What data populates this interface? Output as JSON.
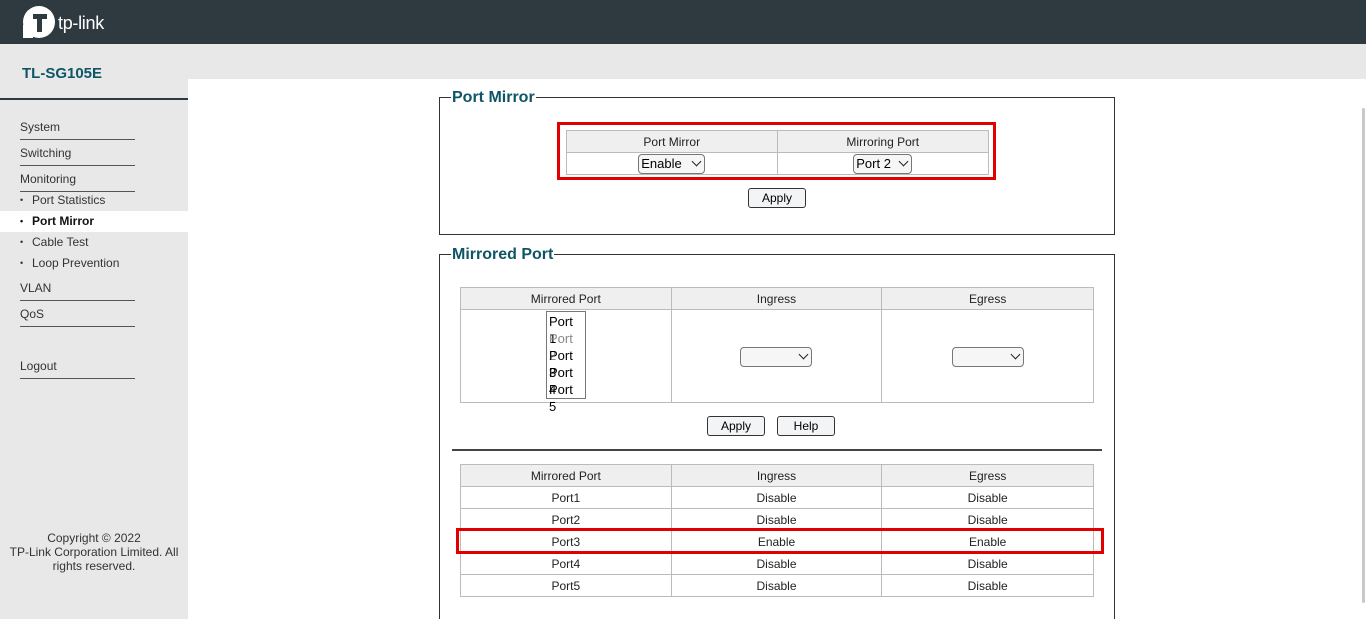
{
  "brand": {
    "logo_text": "tp-link",
    "model": "TL-SG105E"
  },
  "sidebar": {
    "main_items": [
      {
        "label": "System"
      },
      {
        "label": "Switching"
      },
      {
        "label": "Monitoring"
      },
      {
        "label": "VLAN"
      },
      {
        "label": "QoS"
      },
      {
        "label": "Logout"
      }
    ],
    "sub_items": [
      {
        "label": "Port Statistics",
        "active": false
      },
      {
        "label": "Port Mirror",
        "active": true
      },
      {
        "label": "Cable Test",
        "active": false
      },
      {
        "label": "Loop Prevention",
        "active": false
      }
    ],
    "bullet": "•",
    "copyright": "Copyright © 2022\nTP-Link Corporation Limited. All rights reserved."
  },
  "port_mirror": {
    "title": "Port Mirror",
    "headers": [
      "Port Mirror",
      "Mirroring Port"
    ],
    "port_mirror_value": "Enable",
    "mirroring_port_value": "Port 2",
    "apply_label": "Apply"
  },
  "mirrored_port": {
    "title": "Mirrored Port",
    "headers": [
      "Mirrored Port",
      "Ingress",
      "Egress"
    ],
    "port_list": [
      {
        "label": "Port 1",
        "disabled": false
      },
      {
        "label": "Port 2",
        "disabled": true
      },
      {
        "label": "Port 3",
        "disabled": false
      },
      {
        "label": "Port 4",
        "disabled": false
      },
      {
        "label": "Port 5",
        "disabled": false
      }
    ],
    "ingress_value": "",
    "egress_value": "",
    "apply_label": "Apply",
    "help_label": "Help",
    "status_headers": [
      "Mirrored Port",
      "Ingress",
      "Egress"
    ],
    "status_rows": [
      {
        "port": "Port1",
        "ingress": "Disable",
        "egress": "Disable"
      },
      {
        "port": "Port2",
        "ingress": "Disable",
        "egress": "Disable"
      },
      {
        "port": "Port3",
        "ingress": "Enable",
        "egress": "Enable"
      },
      {
        "port": "Port4",
        "ingress": "Disable",
        "egress": "Disable"
      },
      {
        "port": "Port5",
        "ingress": "Disable",
        "egress": "Disable"
      }
    ]
  },
  "colors": {
    "accent": "#0e5566",
    "topbar": "#2e3a40",
    "highlight": "#e00000"
  },
  "icons": {
    "logo": "tp-link-logo-icon",
    "dropdown": "chevron-down-icon"
  }
}
